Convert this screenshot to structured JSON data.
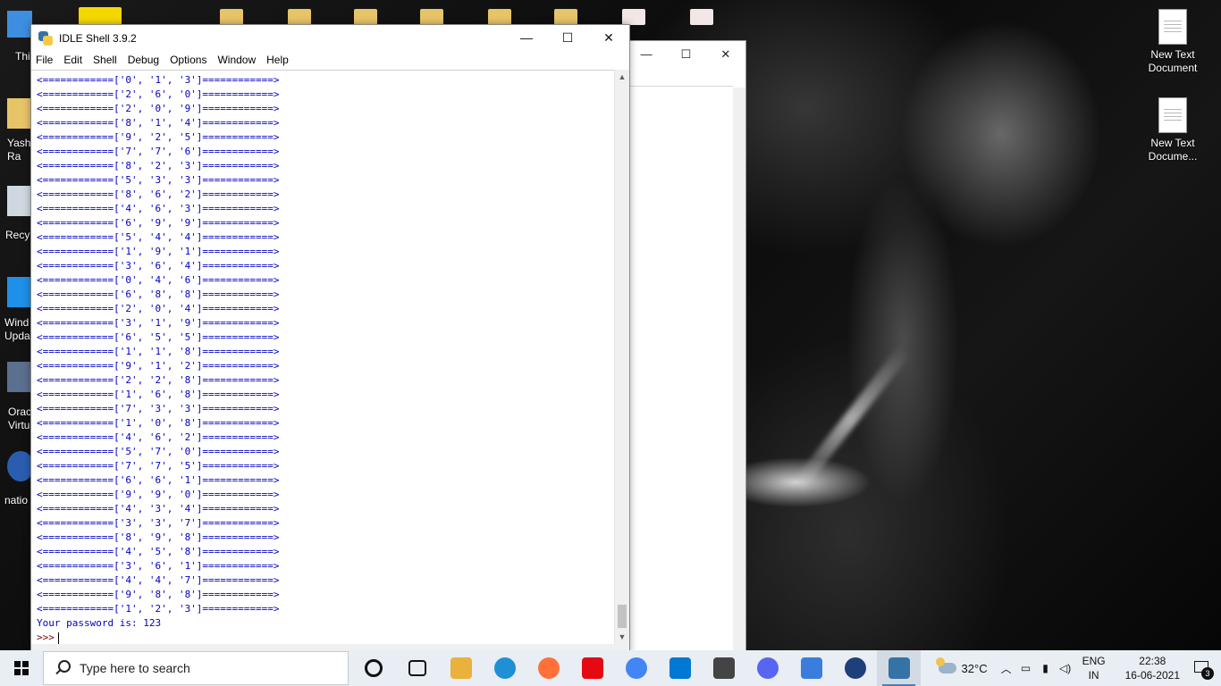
{
  "desktop": {
    "right_icons": [
      {
        "label": "New Text Document"
      },
      {
        "label": "New Text Docume..."
      }
    ],
    "left_icons": [
      {
        "label": "Thi"
      },
      {
        "label": "Yash Ra"
      },
      {
        "label": "Recy"
      },
      {
        "label": "Wind Upda"
      },
      {
        "label": "Orac Virtu"
      },
      {
        "label": "natio"
      }
    ]
  },
  "idle": {
    "title": "IDLE Shell 3.9.2",
    "window_controls": {
      "minimize": "—",
      "maximize": "☐",
      "close": "✕"
    },
    "menu": [
      "File",
      "Edit",
      "Shell",
      "Debug",
      "Options",
      "Window",
      "Help"
    ],
    "output_lines": [
      "<============['0', '1', '3']============>",
      "<============['2', '6', '0']============>",
      "<============['2', '0', '9']============>",
      "<============['8', '1', '4']============>",
      "<============['9', '2', '5']============>",
      "<============['7', '7', '6']============>",
      "<============['8', '2', '3']============>",
      "<============['5', '3', '3']============>",
      "<============['8', '6', '2']============>",
      "<============['4', '6', '3']============>",
      "<============['6', '9', '9']============>",
      "<============['5', '4', '4']============>",
      "<============['1', '9', '1']============>",
      "<============['3', '6', '4']============>",
      "<============['0', '4', '6']============>",
      "<============['6', '8', '8']============>",
      "<============['2', '0', '4']============>",
      "<============['3', '1', '9']============>",
      "<============['6', '5', '5']============>",
      "<============['1', '1', '8']============>",
      "<============['9', '1', '2']============>",
      "<============['2', '2', '8']============>",
      "<============['1', '6', '8']============>",
      "<============['7', '3', '3']============>",
      "<============['1', '0', '8']============>",
      "<============['4', '6', '2']============>",
      "<============['5', '7', '0']============>",
      "<============['7', '7', '5']============>",
      "<============['6', '6', '1']============>",
      "<============['9', '9', '0']============>",
      "<============['4', '3', '4']============>",
      "<============['3', '3', '7']============>",
      "<============['8', '9', '8']============>",
      "<============['4', '5', '8']============>",
      "<============['3', '6', '1']============>",
      "<============['4', '4', '7']============>",
      "<============['9', '8', '8']============>",
      "<============['1', '2', '3']============>"
    ],
    "result_line": "Your password is: 123",
    "prompt": ">>>"
  },
  "taskbar": {
    "search_placeholder": "Type here to search",
    "apps": [
      {
        "name": "task-view-icon",
        "color": "#111111"
      },
      {
        "name": "widgets-icon",
        "color": "#111111"
      },
      {
        "name": "file-explorer-icon",
        "color": "#e8b23c"
      },
      {
        "name": "edge-icon",
        "color": "#1f8fd6"
      },
      {
        "name": "firefox-icon",
        "color": "#ff7139"
      },
      {
        "name": "netflix-icon",
        "color": "#e50914"
      },
      {
        "name": "chrome-icon",
        "color": "#4285f4"
      },
      {
        "name": "vscode-icon",
        "color": "#0078d4"
      },
      {
        "name": "store-icon",
        "color": "#444444"
      },
      {
        "name": "discord-icon",
        "color": "#5865f2"
      },
      {
        "name": "w-app-icon",
        "color": "#3b7ddd"
      },
      {
        "name": "paper-plane-app-icon",
        "color": "#1f3f7a"
      },
      {
        "name": "python-idle-icon",
        "color": "#3572a5"
      }
    ],
    "weather": "32°C",
    "tray_icons": [
      "chevron-up-icon",
      "network-icon",
      "battery-icon",
      "speaker-icon"
    ],
    "language": {
      "line1": "ENG",
      "line2": "IN"
    },
    "time": "22:38",
    "date": "16-06-2021",
    "notification_count": "3"
  }
}
